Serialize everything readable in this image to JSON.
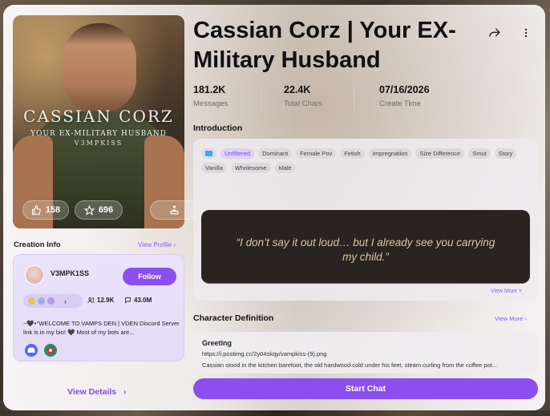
{
  "character": {
    "name": "Cassian Corz | Your EX-Military Husband",
    "portrait_title": "CASSIAN CORZ",
    "portrait_subtitle": "YOUR EX-MILITARY HUSBAND",
    "portrait_author": "V3MPKISS"
  },
  "reactions": {
    "likes": "158",
    "favorites": "696",
    "gift_icon": "gift-icon"
  },
  "stats": [
    {
      "value": "181.2K",
      "label": "Messages"
    },
    {
      "value": "22.4K",
      "label": "Total Chars"
    },
    {
      "value": "07/16/2026",
      "label": "Create Time"
    }
  ],
  "creation": {
    "heading": "Creation Info",
    "view_profile": "View Profile",
    "creator_name": "V3MPK1SS",
    "follow_label": "Follow",
    "followers": "12.9K",
    "chats": "43.0M",
    "bio": "~🖤•°WELCOME TO VAMPS DEN | VDEN Discord Server link is in my bio! 🖤 Most of my bots are...",
    "view_details": "View Details"
  },
  "introduction": {
    "heading": "Introduction",
    "tags": [
      "Unfiltered",
      "Dominant",
      "Female Pov",
      "Fetish",
      "Impregnation",
      "Size Difference",
      "Smut",
      "Story",
      "Vanilla",
      "Wholesome",
      "Male"
    ],
    "quote_line1": "“I don’t say it out loud… but I already see you carrying",
    "quote_line2": "my child.”",
    "view_more": "View More"
  },
  "definition": {
    "heading": "Character Definition",
    "view_more": "View More",
    "greeting_title": "Greeting",
    "greeting_url": "https://i.postimg.cc/2y04skqy/vampkiss-(9).png",
    "greeting_text": "Cassian stood in the kitchen barefoot, the old hardwood cold under his feet, steam curling from the coffee pot..."
  },
  "actions": {
    "start_chat": "Start Chat"
  },
  "colors": {
    "accent": "#8b4ff0",
    "accent_text": "#7a4fd8"
  }
}
